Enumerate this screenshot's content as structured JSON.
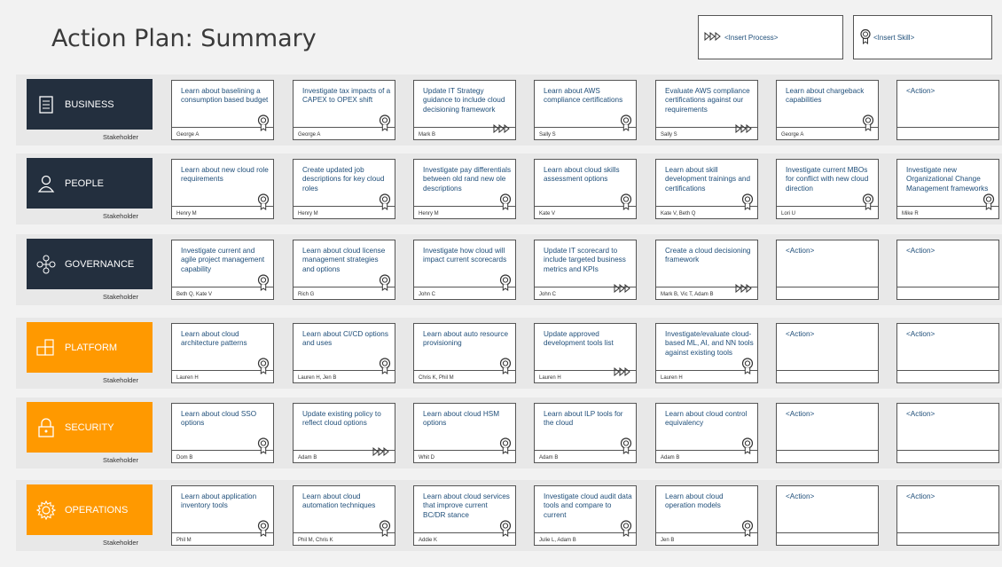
{
  "title": "Action Plan: Summary",
  "legend": {
    "process": "<Insert Process>",
    "skill": "<Insert Skill>"
  },
  "stakeholder_label": "Stakeholder",
  "rows": [
    {
      "name": "BUSINESS",
      "icon": "document-icon",
      "theme": "dark",
      "cards": [
        {
          "text": "Learn about baselining a consumption based budget",
          "owner": "George A",
          "mark": "skill"
        },
        {
          "text": "Investigate tax impacts of a CAPEX to OPEX shift",
          "owner": "George A",
          "mark": "skill"
        },
        {
          "text": "Update IT Strategy guidance to include cloud decisioning framework",
          "owner": "Mark B",
          "mark": "process"
        },
        {
          "text": "Learn about AWS compliance certifications",
          "owner": "Sally S",
          "mark": "skill"
        },
        {
          "text": "Evaluate AWS compliance certifications against our requirements",
          "owner": "Sally S",
          "mark": "process"
        },
        {
          "text": "Learn about chargeback capabilities",
          "owner": "George A",
          "mark": "skill"
        },
        {
          "text": "<Action>",
          "owner": "",
          "mark": ""
        }
      ]
    },
    {
      "name": "PEOPLE",
      "icon": "person-icon",
      "theme": "dark",
      "cards": [
        {
          "text": "Learn about new cloud role requirements",
          "owner": "Henry M",
          "mark": "skill"
        },
        {
          "text": "Create updated job descriptions for key cloud roles",
          "owner": "Henry M",
          "mark": "skill"
        },
        {
          "text": "Investigate pay differentials between old rand new ole descriptions",
          "owner": "Henry M",
          "mark": "skill"
        },
        {
          "text": "Learn about cloud skills assessment options",
          "owner": "Kate V",
          "mark": "skill"
        },
        {
          "text": "Learn about skill development trainings and certifications",
          "owner": "Kate V, Beth Q",
          "mark": "skill"
        },
        {
          "text": "Investigate current MBOs for conflict with new cloud direction",
          "owner": "Lori U",
          "mark": "skill"
        },
        {
          "text": "Investigate new Organizational Change Management frameworks",
          "owner": "Mike R",
          "mark": "skill"
        }
      ]
    },
    {
      "name": "GOVERNANCE",
      "icon": "network-icon",
      "theme": "dark",
      "cards": [
        {
          "text": "Investigate current and agile project management capability",
          "owner": "Beth Q, Kate V",
          "mark": "skill"
        },
        {
          "text": "Learn about cloud license management strategies and options",
          "owner": "Rich G",
          "mark": "skill"
        },
        {
          "text": "Investigate how cloud will impact current scorecards",
          "owner": "John C",
          "mark": "skill"
        },
        {
          "text": "Update IT scorecard to include targeted business metrics and KPIs",
          "owner": "John C",
          "mark": "process"
        },
        {
          "text": "Create a cloud decisioning framework",
          "owner": "Mark B, Vic T, Adam B",
          "mark": "process"
        },
        {
          "text": "<Action>",
          "owner": "",
          "mark": ""
        },
        {
          "text": "<Action>",
          "owner": "",
          "mark": ""
        }
      ]
    },
    {
      "name": "PLATFORM",
      "icon": "blocks-icon",
      "theme": "orange",
      "cards": [
        {
          "text": "Learn about cloud architecture patterns",
          "owner": "Lauren H",
          "mark": "skill"
        },
        {
          "text": "Learn about CI/CD options and uses",
          "owner": "Lauren H, Jen B",
          "mark": "skill"
        },
        {
          "text": "Learn about auto resource provisioning",
          "owner": "Chris K, Phil M",
          "mark": "skill"
        },
        {
          "text": "Update approved development tools list",
          "owner": "Lauren H",
          "mark": "process"
        },
        {
          "text": "Investigate/evaluate cloud-based ML, AI, and NN tools against existing tools",
          "owner": "Lauren H",
          "mark": "skill"
        },
        {
          "text": "<Action>",
          "owner": "",
          "mark": ""
        },
        {
          "text": "<Action>",
          "owner": "",
          "mark": ""
        }
      ]
    },
    {
      "name": "SECURITY",
      "icon": "lock-icon",
      "theme": "orange",
      "cards": [
        {
          "text": "Learn about cloud SSO options",
          "owner": "Dom B",
          "mark": "skill"
        },
        {
          "text": "Update existing policy to reflect cloud options",
          "owner": "Adam B",
          "mark": "process"
        },
        {
          "text": "Learn about cloud HSM options",
          "owner": "Whit D",
          "mark": "skill"
        },
        {
          "text": "Learn about ILP tools for the cloud",
          "owner": "Adam B",
          "mark": "skill"
        },
        {
          "text": "Learn about cloud control equivalency",
          "owner": "Adam B",
          "mark": "skill"
        },
        {
          "text": "<Action>",
          "owner": "",
          "mark": ""
        },
        {
          "text": "<Action>",
          "owner": "",
          "mark": ""
        }
      ]
    },
    {
      "name": "OPERATIONS",
      "icon": "gear-icon",
      "theme": "orange",
      "cards": [
        {
          "text": "Learn about application inventory tools",
          "owner": "Phil M",
          "mark": "skill"
        },
        {
          "text": "Learn about cloud automation techniques",
          "owner": "Phil M, Chris K",
          "mark": "skill"
        },
        {
          "text": "Learn about cloud services that improve current BC/DR stance",
          "owner": "Addie K",
          "mark": "skill"
        },
        {
          "text": "Investigate cloud audit data tools and compare to current",
          "owner": "Julie L, Adam B",
          "mark": "skill"
        },
        {
          "text": "Learn about cloud operation models",
          "owner": "Jen B",
          "mark": "skill"
        },
        {
          "text": "<Action>",
          "owner": "",
          "mark": ""
        },
        {
          "text": "<Action>",
          "owner": "",
          "mark": ""
        }
      ]
    }
  ]
}
